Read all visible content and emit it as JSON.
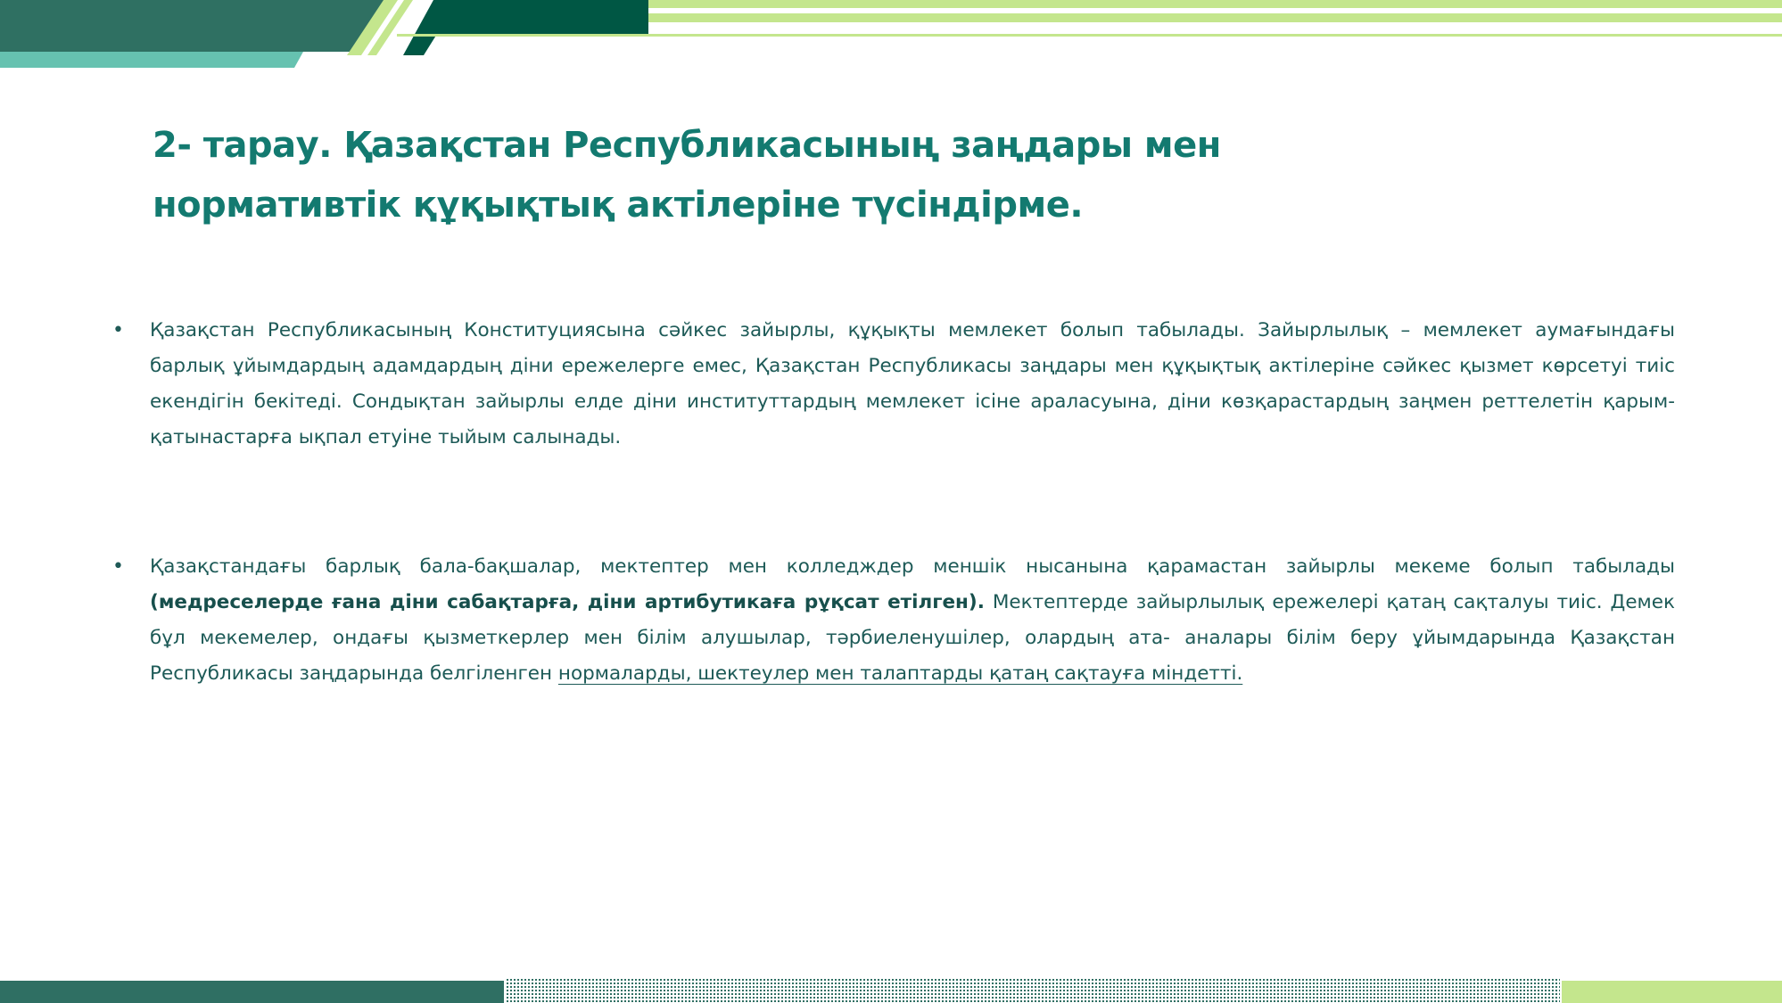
{
  "slide": {
    "title_line_1": "2- тарау. Қазақстан Республикасының заңдары мен",
    "title_line_2": "нормативтік құқықтық актілеріне түсіндірме.",
    "bullets": [
      {
        "text": "Қазақстан Республикасының Конституциясына сәйкес зайырлы, құқықты мемлекет болып табылады. Зайырлылық – мемлекет аумағындағы барлық ұйымдардың адамдардың діни ережелерге емес, Қазақстан Республикасы заңдары мен құқықтық актілеріне сәйкес қызмет көрсетуі тиіс екендігін бекітеді. Сондықтан зайырлы елде діни институттардың мемлекет ісіне араласуына, діни көзқарастардың заңмен реттелетін қарым- қатынастарға ықпал етуіне тыйым салынады."
      },
      {
        "text_start": "Қазақстандағы барлық бала-бақшалар, мектептер мен колледждер меншік нысанына қарамастан зайырлы мекеме болып табылады ",
        "text_bold": "(медреселерде ғана діни сабақтарға, діни артибутикаға рұқсат етілген).",
        "text_middle": " Мектептерде зайырлылық ережелері қатаң сақталуы тиіс. Демек бұл мекемелер, ондағы қызметкерлер мен білім алушылар, тәрбиеленушілер, олардың ата- аналары білім беру ұйымдарында Қазақстан Республикасы заңдарында белгіленген ",
        "text_underlined": "нормаларды, шектеулер мен талаптарды қатаң сақтауға міндетті."
      }
    ],
    "bullet_symbol": "•"
  },
  "colors": {
    "title": "#137a70",
    "body_text": "#1d5a57",
    "dark_teal": "#1e5f56",
    "teal": "#2f7a6c",
    "mint": "#66c2b0",
    "deep_green": "#005744",
    "lime": "#c4e68d"
  }
}
